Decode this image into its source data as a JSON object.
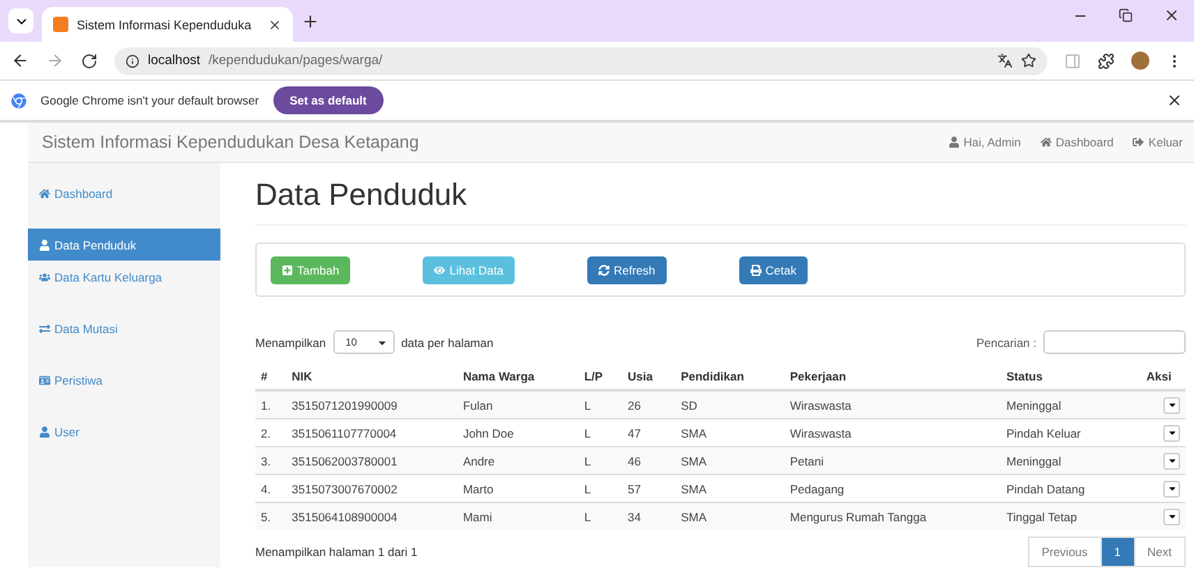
{
  "browser": {
    "tab_title": "Sistem Informasi Kependuduka",
    "url_host": "localhost",
    "url_path": "/kependudukan/pages/warga/",
    "infobar_text": "Google Chrome isn't your default browser",
    "infobar_button": "Set as default"
  },
  "navbar": {
    "brand": "Sistem Informasi Kependudukan Desa Ketapang",
    "links": [
      {
        "label": "Hai, Admin"
      },
      {
        "label": "Dashboard"
      },
      {
        "label": "Keluar"
      }
    ]
  },
  "sidebar": {
    "items": [
      {
        "label": "Dashboard",
        "selected": false
      },
      {
        "label": "Data Penduduk",
        "selected": true
      },
      {
        "label": "Data Kartu Keluarga",
        "selected": false
      },
      {
        "label": "Data Mutasi",
        "selected": false
      },
      {
        "label": "Peristiwa",
        "selected": false
      },
      {
        "label": "User",
        "selected": false
      }
    ]
  },
  "page_title": "Data Penduduk",
  "actions": [
    {
      "kind": "success",
      "label": "Tambah"
    },
    {
      "kind": "info",
      "label": "Lihat Data"
    },
    {
      "kind": "primary",
      "label": "Refresh"
    },
    {
      "kind": "primary",
      "label": "Cetak"
    }
  ],
  "table_controls": {
    "show_prefix": "Menampilkan",
    "page_size": "10",
    "show_suffix": "data per halaman",
    "search_label": "Pencarian :"
  },
  "table": {
    "columns": [
      "#",
      "NIK",
      "Nama Warga",
      "L/P",
      "Usia",
      "Pendidikan",
      "Pekerjaan",
      "Status",
      "Aksi"
    ],
    "rows": [
      [
        "1.",
        "3515071201990009",
        "Fulan",
        "L",
        "26",
        "SD",
        "Wiraswasta",
        "Meninggal"
      ],
      [
        "2.",
        "3515061107770004",
        "John Doe",
        "L",
        "47",
        "SMA",
        "Wiraswasta",
        "Pindah Keluar"
      ],
      [
        "3.",
        "3515062003780001",
        "Andre",
        "L",
        "46",
        "SMA",
        "Petani",
        "Meninggal"
      ],
      [
        "4.",
        "3515073007670002",
        "Marto",
        "L",
        "57",
        "SMA",
        "Pedagang",
        "Pindah Datang"
      ],
      [
        "5.",
        "3515064108900004",
        "Mami",
        "L",
        "34",
        "SMA",
        "Mengurus Rumah Tangga",
        "Tinggal Tetap"
      ]
    ]
  },
  "footer": {
    "info": "Menampilkan halaman 1 dari 1",
    "pagination": [
      {
        "label": "Previous",
        "selected": false
      },
      {
        "label": "1",
        "selected": true
      },
      {
        "label": "Next",
        "selected": false
      }
    ]
  }
}
